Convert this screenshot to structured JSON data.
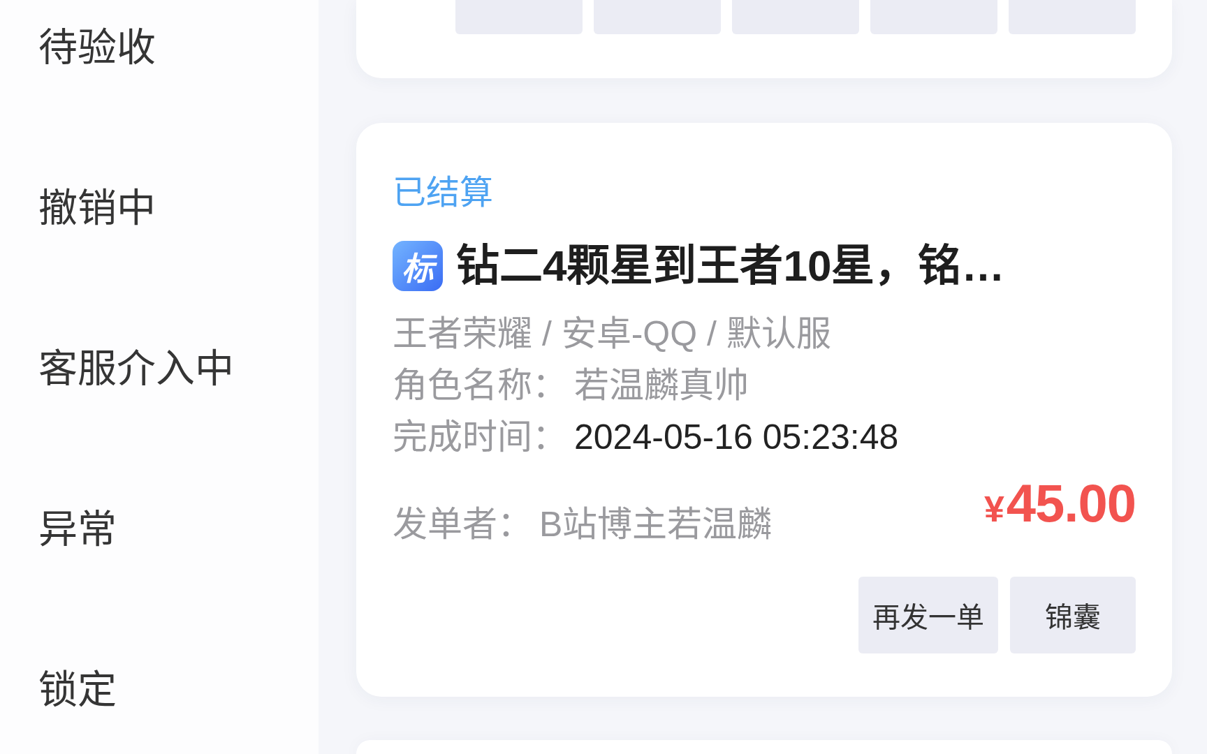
{
  "sidebar": {
    "items": [
      {
        "label": "待验收",
        "selected": false
      },
      {
        "label": "撤销中",
        "selected": false
      },
      {
        "label": "客服介入中",
        "selected": false
      },
      {
        "label": "异常",
        "selected": false
      },
      {
        "label": "锁定",
        "selected": false
      }
    ]
  },
  "orders": [
    {
      "kind": "cut_top",
      "buttons": [
        {
          "kind": "plain"
        },
        {
          "kind": "plain"
        },
        {
          "kind": "plain"
        },
        {
          "kind": "plain"
        },
        {
          "kind": "plain"
        }
      ]
    },
    {
      "kind": "full",
      "status": "已结算",
      "tag": "标",
      "title": "钻二4颗星到王者10星，铭…",
      "game": "王者荣耀 / 安卓-QQ / 默认服",
      "fields": [
        {
          "label": "角色名称：",
          "value": "若温麟真帅",
          "kind": "muted"
        },
        {
          "label": "完成时间：",
          "value": "2024-05-16 05:23:48",
          "kind": "strong"
        }
      ],
      "sender": {
        "label": "发单者：",
        "value": "B站博主若温麟"
      },
      "price": {
        "currency": "¥",
        "amount": "45.00"
      },
      "buttons": [
        {
          "label": "再发一单"
        },
        {
          "label": "锦囊"
        }
      ]
    },
    {
      "kind": "cut_bottom"
    }
  ]
}
